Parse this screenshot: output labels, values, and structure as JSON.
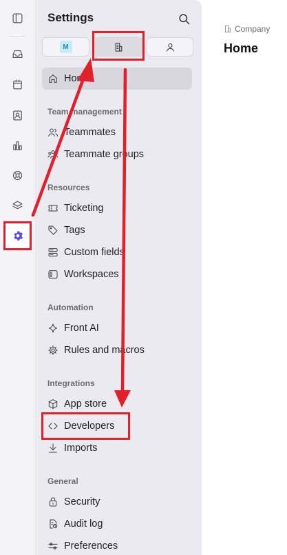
{
  "settings": {
    "title": "Settings",
    "tabs": [
      {
        "name": "workspace",
        "badge": "M"
      },
      {
        "name": "company",
        "icon": "building-icon",
        "selected": true
      },
      {
        "name": "personal",
        "icon": "user-icon"
      }
    ],
    "home_label": "Home",
    "sections": {
      "team": {
        "title": "Team management",
        "items": [
          "Teammates",
          "Teammate groups"
        ]
      },
      "resources": {
        "title": "Resources",
        "items": [
          "Ticketing",
          "Tags",
          "Custom fields",
          "Workspaces"
        ]
      },
      "automation": {
        "title": "Automation",
        "items": [
          "Front AI",
          "Rules and macros"
        ]
      },
      "integrations": {
        "title": "Integrations",
        "items": [
          "App store",
          "Developers",
          "Imports"
        ]
      },
      "general": {
        "title": "General",
        "items": [
          "Security",
          "Audit log",
          "Preferences"
        ]
      }
    }
  },
  "main": {
    "breadcrumb": "Company",
    "title": "Home"
  },
  "colors": {
    "highlight": "#e0202a",
    "accent": "#5b4ee6"
  }
}
